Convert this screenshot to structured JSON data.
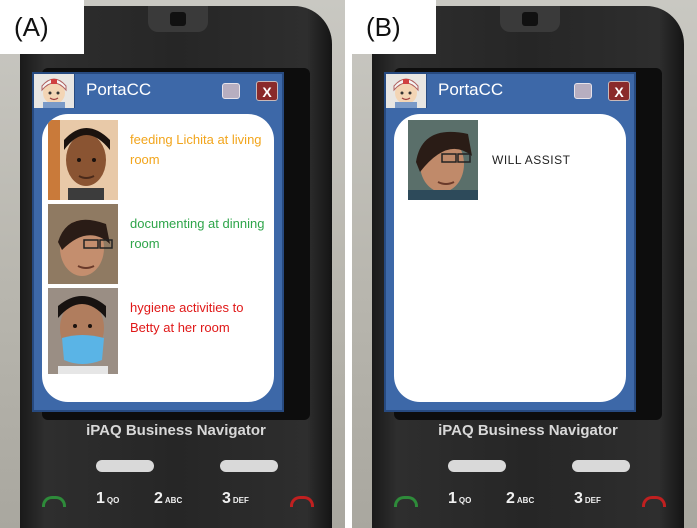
{
  "panels": [
    {
      "tag": "(A)",
      "app": {
        "title": "PortaCC",
        "close_label": "X"
      },
      "rows": [
        {
          "text": "feeding Lichita at living room",
          "color": "#f2a51c"
        },
        {
          "text": "documenting at dinning room",
          "color": "#2ea54a"
        },
        {
          "text": "hygiene activities to Betty at her room",
          "color": "#e01818"
        }
      ],
      "brand": "iPAQ Business Navigator",
      "keys": [
        "1",
        "2",
        "3"
      ],
      "key_subs": [
        "QO",
        "ABC",
        "DEF"
      ]
    },
    {
      "tag": "(B)",
      "app": {
        "title": "PortaCC",
        "close_label": "X"
      },
      "rows": [
        {
          "text": "WILL ASSIST",
          "color": "#222222"
        }
      ],
      "brand": "iPAQ Business Navigator",
      "keys": [
        "1",
        "2",
        "3"
      ],
      "key_subs": [
        "QO",
        "ABC",
        "DEF"
      ]
    }
  ],
  "icons": {
    "logo": "nurse-avatar-icon",
    "minimize": "minimize-icon",
    "close": "close-icon",
    "call": "call-green-icon",
    "end": "call-red-icon"
  }
}
